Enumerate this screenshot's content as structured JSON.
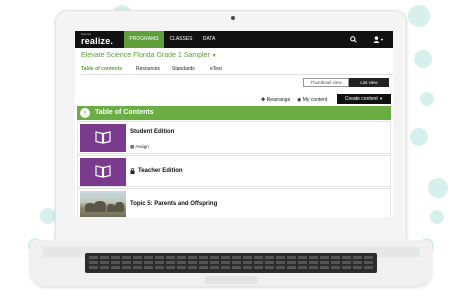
{
  "app": {
    "brand_sub": "Savvas",
    "brand_name": "realize."
  },
  "nav": {
    "tabs": [
      {
        "label": "PROGRAMS",
        "active": true
      },
      {
        "label": "CLASSES",
        "active": false
      },
      {
        "label": "DATA",
        "active": false
      }
    ],
    "icons": [
      "search-icon",
      "user-icon"
    ]
  },
  "course": {
    "title": "Elevate Science Florida Grade 1 Sampler",
    "subnav": [
      "Table of contents",
      "Resources",
      "Standards",
      "eText"
    ]
  },
  "view_toggle": {
    "thumbnail": "Thumbnail view",
    "list": "List view",
    "selected": "list"
  },
  "actions": {
    "rearrange": "Rearrange",
    "my_content": "My content",
    "create_content": "Create content"
  },
  "toc": {
    "title": "Table of Contents",
    "items": [
      {
        "title": "Student Edition",
        "sub": "Assign",
        "thumbnail": "book-icon",
        "locked": false
      },
      {
        "title": "Teacher Edition",
        "sub": "",
        "thumbnail": "book-icon",
        "locked": true
      },
      {
        "title": "Topic 5: Parents and Offspring",
        "sub": "",
        "thumbnail": "photo",
        "locked": false
      }
    ]
  },
  "colors": {
    "accent_green": "#6aad43",
    "nav_active": "#5f9f3a",
    "thumbnail_purple": "#7a3b8f",
    "topbar": "#111111"
  }
}
